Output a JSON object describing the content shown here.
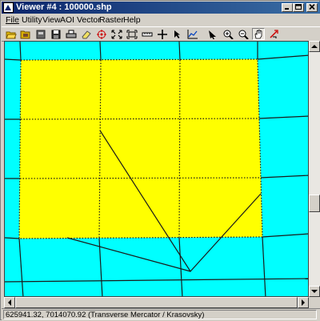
{
  "window": {
    "title": "Viewer #4 : 100000.shp"
  },
  "menu": [
    {
      "label": "File"
    },
    {
      "label": "Utility"
    },
    {
      "label": "View"
    },
    {
      "label": "AOI"
    },
    {
      "label": "Vector"
    },
    {
      "label": "Raster"
    },
    {
      "label": "Help"
    }
  ],
  "toolbar_icons": [
    "open-folder-icon",
    "open-layer-icon",
    "close-layer-icon",
    "save-icon",
    "print-icon",
    "eraser-icon",
    "target-icon",
    "fit-to-window-icon",
    "zoom-extent-icon",
    "measure-ruler-icon",
    "crosshair-icon",
    "inquire-cursor-icon",
    "chart-icon",
    "select-arrow-icon",
    "zoom-in-icon",
    "zoom-out-icon",
    "pan-hand-icon",
    "roam-icon"
  ],
  "status": {
    "text": "625941.32, 7014070.92  (Transverse Mercator / Krasovsky)"
  },
  "map": {
    "background_color": "#00ffff",
    "fill_color": "#ffff00",
    "line_color": "#1a1a1a"
  }
}
